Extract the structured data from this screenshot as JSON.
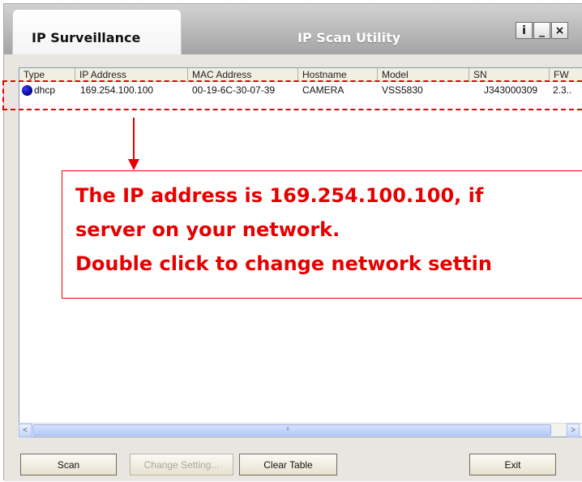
{
  "window": {
    "tab_title": "IP Surveillance",
    "utility_title": "IP Scan Utility",
    "controls": {
      "info": "i",
      "minimize": "_",
      "close": "×"
    }
  },
  "table": {
    "columns": [
      "Type",
      "IP Address",
      "MAC Address",
      "Hostname",
      "Model",
      "SN",
      "FW"
    ],
    "rows": [
      {
        "type": "dhcp",
        "ip": "169.254.100.100",
        "mac": "00-19-6C-30-07-39",
        "hostname": "CAMERA",
        "model": "VSS5830",
        "sn": "J343000309",
        "fw": "2.3.."
      }
    ]
  },
  "scrollbar": {
    "left": "<",
    "right": ">",
    "grip": "III"
  },
  "buttons": {
    "scan": "Scan",
    "change_setting": "Change Setting...",
    "clear_table": "Clear Table",
    "exit": "Exit"
  },
  "annotation": {
    "lines": [
      "The IP address is 169.254.100.100, if",
      "server on your network.",
      "Double click to change network settin"
    ],
    "color": "#e60000"
  },
  "colors": {
    "status_dot": "#000080",
    "accent_red": "#e60000"
  }
}
